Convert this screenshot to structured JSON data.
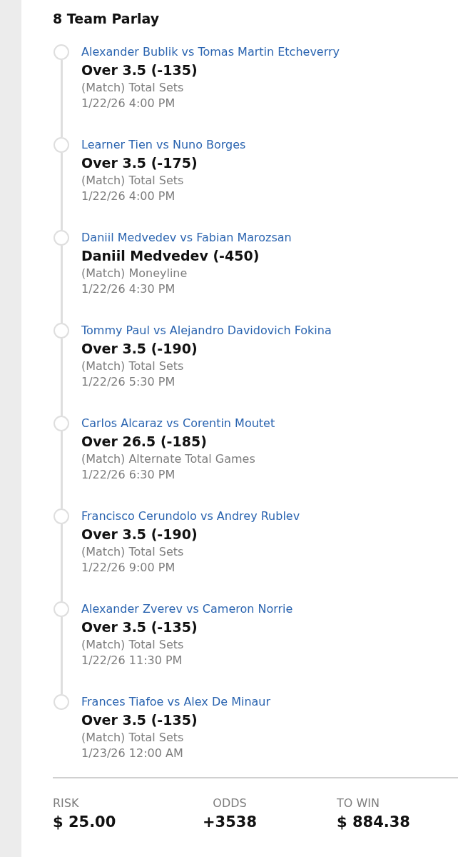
{
  "title": "8 Team Parlay",
  "legs": [
    {
      "matchup": "Alexander Bublik vs Tomas Martin Etcheverry",
      "selection": "Over 3.5 (-135)",
      "market": "(Match) Total Sets",
      "time": "1/22/26 4:00 PM"
    },
    {
      "matchup": "Learner Tien vs Nuno Borges",
      "selection": "Over 3.5 (-175)",
      "market": "(Match) Total Sets",
      "time": "1/22/26 4:00 PM"
    },
    {
      "matchup": "Daniil Medvedev vs Fabian Marozsan",
      "selection": "Daniil Medvedev (-450)",
      "market": "(Match) Moneyline",
      "time": "1/22/26 4:30 PM"
    },
    {
      "matchup": "Tommy Paul vs Alejandro Davidovich Fokina",
      "selection": "Over 3.5 (-190)",
      "market": "(Match) Total Sets",
      "time": "1/22/26 5:30 PM"
    },
    {
      "matchup": "Carlos Alcaraz vs Corentin Moutet",
      "selection": "Over 26.5 (-185)",
      "market": "(Match) Alternate Total Games",
      "time": "1/22/26 6:30 PM"
    },
    {
      "matchup": "Francisco Cerundolo vs Andrey Rublev",
      "selection": "Over 3.5 (-190)",
      "market": "(Match) Total Sets",
      "time": "1/22/26 9:00 PM"
    },
    {
      "matchup": "Alexander Zverev vs Cameron Norrie",
      "selection": "Over 3.5 (-135)",
      "market": "(Match) Total Sets",
      "time": "1/22/26 11:30 PM"
    },
    {
      "matchup": "Frances Tiafoe vs Alex De Minaur",
      "selection": "Over 3.5 (-135)",
      "market": "(Match) Total Sets",
      "time": "1/23/26 12:00 AM"
    }
  ],
  "summary": [
    {
      "label": "RISK",
      "value": "$ 25.00"
    },
    {
      "label": "ODDS",
      "value": "+3538"
    },
    {
      "label": "TO WIN",
      "value": "$ 884.38"
    }
  ]
}
